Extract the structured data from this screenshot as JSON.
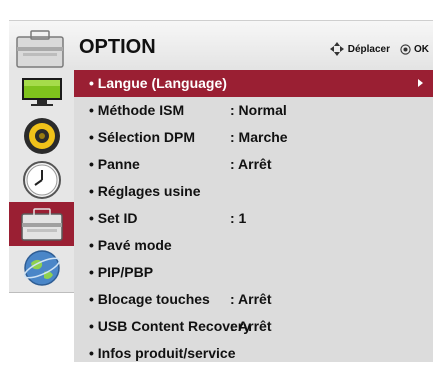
{
  "header": {
    "title": "OPTION",
    "move_hint": "Déplacer",
    "ok_hint": "OK"
  },
  "categories": [
    {
      "icon": "picture-icon",
      "selected": false
    },
    {
      "icon": "sound-icon",
      "selected": false
    },
    {
      "icon": "time-icon",
      "selected": false
    },
    {
      "icon": "option-toolbox-icon",
      "selected": true
    },
    {
      "icon": "network-globe-icon",
      "selected": false
    }
  ],
  "menu": [
    {
      "label": "• Langue (Language)",
      "value": "",
      "selected": true,
      "submenu": true
    },
    {
      "label": "• Méthode ISM",
      "value": ": Normal",
      "selected": false
    },
    {
      "label": "• Sélection DPM",
      "value": ": Marche",
      "selected": false
    },
    {
      "label": "• Panne",
      "value": ": Arrêt",
      "selected": false
    },
    {
      "label": "• Réglages usine",
      "value": "",
      "selected": false
    },
    {
      "label": "• Set ID",
      "value": ": 1",
      "selected": false
    },
    {
      "label": "• Pavé mode",
      "value": "",
      "selected": false
    },
    {
      "label": "• PIP/PBP",
      "value": "",
      "selected": false
    },
    {
      "label": "• Blocage touches",
      "value": ": Arrêt",
      "selected": false
    },
    {
      "label": "• USB Content Recovery",
      "value": ": Arrêt",
      "selected": false
    },
    {
      "label": "• Infos produit/service",
      "value": "",
      "selected": false
    }
  ],
  "colors": {
    "accent": "#9a1f33",
    "panel": "#dcdcdc",
    "rail": "#e6e6e6"
  }
}
